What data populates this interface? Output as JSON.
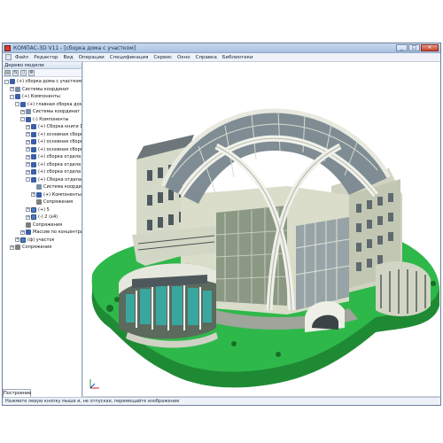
{
  "window": {
    "title": "КОМПАС-3D V11 - [сборка дома с участком]"
  },
  "title_buttons": {
    "minimize": "_",
    "maximize": "□",
    "close": "×"
  },
  "menu": [
    "Файл",
    "Редактор",
    "Вид",
    "Операции",
    "Спецификация",
    "Сервис",
    "Окно",
    "Справка",
    "Библиотеки"
  ],
  "panel": {
    "header": "Дерево модели",
    "toolbar": [
      "▤",
      "⇆",
      "▯",
      "⚙"
    ],
    "tab": "Построение"
  },
  "tree": [
    {
      "label": "(+) сборка дома с участком (Тел.0)",
      "exp": "-",
      "icon": "assembly"
    },
    {
      "label": "Системы координат",
      "exp": "+",
      "icon": "coord"
    },
    {
      "label": "(+) Компоненты",
      "exp": "-",
      "icon": "assembly"
    },
    {
      "label": "(+) главная сборка дома",
      "exp": "-",
      "icon": "assembly"
    },
    {
      "label": "Системы координат",
      "exp": "+",
      "icon": "coord"
    },
    {
      "label": "(-) Компоненты",
      "exp": "-",
      "icon": "assembly"
    },
    {
      "label": "(+) Сборка книги 1",
      "exp": "+",
      "icon": "assembly"
    },
    {
      "label": "(+) основная сборка",
      "exp": "+",
      "icon": "assembly"
    },
    {
      "label": "(+) основная сборка",
      "exp": "+",
      "icon": "assembly"
    },
    {
      "label": "(+) основная сборка",
      "exp": "+",
      "icon": "assembly"
    },
    {
      "label": "(+) сборка отдела",
      "exp": "+",
      "icon": "assembly"
    },
    {
      "label": "(+) сборка отдела",
      "exp": "+",
      "icon": "assembly"
    },
    {
      "label": "(+) сборка отдела",
      "exp": "+",
      "icon": "assembly"
    },
    {
      "label": "(+) Сборка отдела",
      "exp": "-",
      "icon": "assembly"
    },
    {
      "label": "Система координ",
      "exp": "",
      "icon": "coord"
    },
    {
      "label": "(+) Компоненты",
      "exp": "+",
      "icon": "assembly"
    },
    {
      "label": "Сопряжения",
      "exp": "",
      "icon": "link"
    },
    {
      "label": "(+) 5",
      "exp": "+",
      "icon": "part"
    },
    {
      "label": "(-) 2 (x4)",
      "exp": "+",
      "icon": "part"
    },
    {
      "label": "Сопряжения",
      "exp": "",
      "icon": "link"
    },
    {
      "label": "Массив по концентрич",
      "exp": "+",
      "icon": "assembly"
    },
    {
      "label": "(ф) участок",
      "exp": "+",
      "icon": "part"
    },
    {
      "label": "Сопряжения",
      "exp": "+",
      "icon": "link"
    }
  ],
  "tree_indent": [
    0,
    1,
    1,
    2,
    3,
    3,
    4,
    4,
    4,
    4,
    4,
    4,
    4,
    4,
    5,
    5,
    5,
    4,
    4,
    3,
    3,
    2,
    1
  ],
  "status": "Нажмите левую кнопку мыши и, не отпуская, перемещайте изображение",
  "colors": {
    "lawn": "#2fb84a",
    "lawn_dark": "#1f8a34",
    "roof_glass": "#7f8c93",
    "walls": "#d9ddc9",
    "title_bar": "#b7cbe6"
  }
}
